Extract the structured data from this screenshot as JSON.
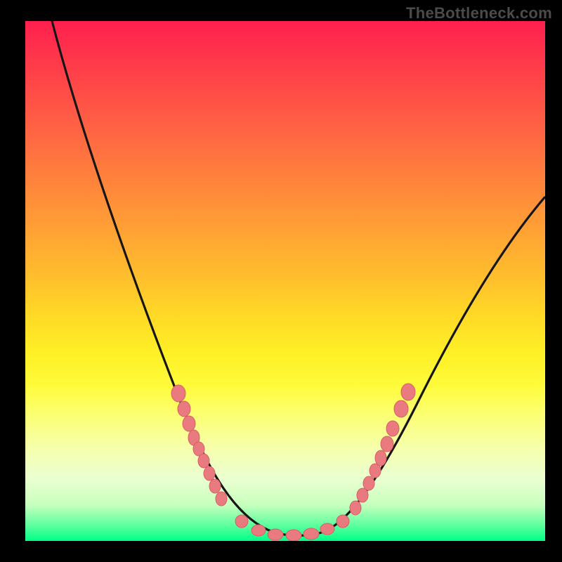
{
  "watermark": "TheBottleneck.com",
  "colors": {
    "page_bg": "#000000",
    "watermark_text": "#4b4b4b",
    "curve_stroke": "#161616",
    "dot_fill": "#e97a7f",
    "dot_stroke": "#d85f63",
    "gradient_top": "#ff1f4f",
    "gradient_bottom": "#00ff86"
  },
  "chart_data": {
    "type": "line",
    "title": "",
    "xlabel": "",
    "ylabel": "",
    "xlim": [
      0,
      100
    ],
    "ylim": [
      0,
      100
    ],
    "grid": false,
    "series": [
      {
        "name": "bottleneck-curve",
        "x": [
          5,
          10,
          14,
          18,
          22,
          26,
          30,
          34,
          38,
          41,
          44,
          47,
          50,
          53,
          57,
          60,
          64,
          68,
          72,
          76,
          80,
          84,
          88,
          92,
          96,
          100
        ],
        "y": [
          100,
          86,
          75,
          64,
          54,
          44,
          35,
          27,
          19,
          13,
          8,
          4,
          2,
          2,
          3,
          6,
          10,
          16,
          22,
          29,
          36,
          42,
          49,
          55,
          61,
          67
        ]
      }
    ],
    "points": [
      {
        "name": "left-cluster",
        "x_approx": [
          30,
          31,
          32,
          33,
          33,
          34,
          35,
          36,
          37
        ],
        "y_approx": [
          34,
          31,
          28,
          26,
          24,
          22,
          19,
          17,
          14
        ]
      },
      {
        "name": "valley",
        "x_approx": [
          41,
          44,
          47,
          50,
          53,
          56,
          58
        ],
        "y_approx": [
          6,
          3,
          1,
          1,
          1,
          2,
          4
        ]
      },
      {
        "name": "right-cluster",
        "x_approx": [
          60,
          62,
          63,
          64,
          65,
          66,
          67,
          69
        ],
        "y_approx": [
          9,
          12,
          14,
          16,
          18,
          21,
          24,
          28
        ]
      }
    ],
    "notes": "Axes are not labeled in the image; x and y are normalized 0–100 across the plotted area estimated from pixel positions."
  }
}
